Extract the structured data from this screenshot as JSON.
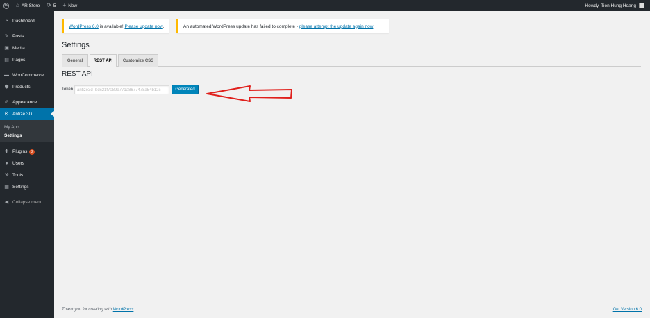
{
  "adminbar": {
    "site_name": "AR Store",
    "updates_count": "5",
    "new_label": "New",
    "howdy": "Howdy, Tien Hung Hoang"
  },
  "sidebar": {
    "items": [
      {
        "label": "Dashboard",
        "icon": "dashboard-icon"
      },
      {
        "label": "Posts",
        "icon": "pin-icon"
      },
      {
        "label": "Media",
        "icon": "media-icon"
      },
      {
        "label": "Pages",
        "icon": "page-icon"
      },
      {
        "label": "WooCommerce",
        "icon": "woocommerce-icon"
      },
      {
        "label": "Products",
        "icon": "products-icon"
      },
      {
        "label": "Appearance",
        "icon": "brush-icon"
      },
      {
        "label": "Antize 3D",
        "icon": "gear-icon"
      }
    ],
    "submenu": [
      "My App",
      "Settings"
    ],
    "lower": [
      {
        "label": "Plugins",
        "icon": "plugin-icon",
        "badge": "2"
      },
      {
        "label": "Users",
        "icon": "users-icon"
      },
      {
        "label": "Tools",
        "icon": "wrench-icon"
      },
      {
        "label": "Settings",
        "icon": "settings-icon"
      },
      {
        "label": "Collapse menu",
        "icon": "collapse-icon"
      }
    ]
  },
  "notices": {
    "update_link1": "WordPress 6.0",
    "update_middle": " is available! ",
    "update_link2": "Please update now",
    "update_end": ".",
    "auto_text": "An automated WordPress update has failed to complete - ",
    "auto_link": "please attempt the update again now",
    "auto_end": "."
  },
  "page": {
    "title": "Settings",
    "tabs": [
      "General",
      "REST API",
      "Customize CSS"
    ],
    "section_title": "REST API",
    "token_label": "Token",
    "token_value": "antize3d_bdc21f7089a771a8677478a54b12c",
    "generated_label": "Generated"
  },
  "footer": {
    "thanks": "Thank you for creating with ",
    "wp_link": "WordPress",
    "thanks_end": ".",
    "version": "Get Version 6.0"
  },
  "colors": {
    "accent": "#0073aa",
    "button": "#0085ba",
    "notice_border": "#ffb900",
    "arrow": "#e0201c"
  }
}
